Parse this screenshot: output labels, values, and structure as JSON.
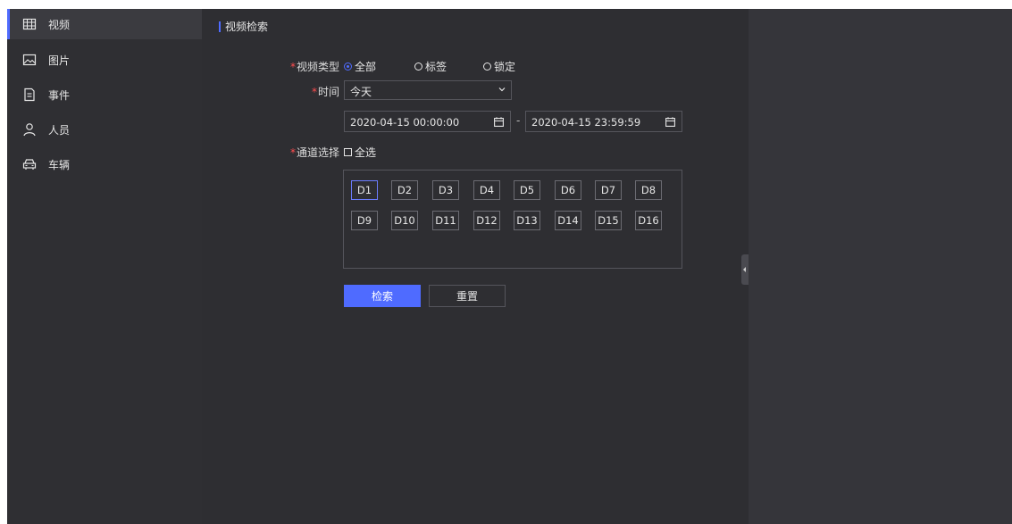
{
  "sidebar": {
    "items": [
      {
        "label": "视频",
        "icon": "video-icon",
        "active": true
      },
      {
        "label": "图片",
        "icon": "image-icon",
        "active": false
      },
      {
        "label": "事件",
        "icon": "document-icon",
        "active": false
      },
      {
        "label": "人员",
        "icon": "person-icon",
        "active": false
      },
      {
        "label": "车辆",
        "icon": "car-icon",
        "active": false
      }
    ]
  },
  "main": {
    "title": "视频检索",
    "video_type": {
      "label": "视频类型",
      "options": [
        "全部",
        "标签",
        "锁定"
      ],
      "selected": "全部"
    },
    "time": {
      "label": "时间",
      "value": "今天",
      "start": "2020-04-15 00:00:00",
      "end": "2020-04-15 23:59:59",
      "separator": "-"
    },
    "channel": {
      "label": "通道选择",
      "select_all": "全选",
      "channels": [
        "D1",
        "D2",
        "D3",
        "D4",
        "D5",
        "D6",
        "D7",
        "D8",
        "D9",
        "D10",
        "D11",
        "D12",
        "D13",
        "D14",
        "D15",
        "D16"
      ],
      "active": "D1"
    },
    "buttons": {
      "search": "检索",
      "reset": "重置"
    }
  },
  "colors": {
    "accent": "#4f6bff",
    "required": "#ff4d4f",
    "background": "#2e2e32"
  }
}
